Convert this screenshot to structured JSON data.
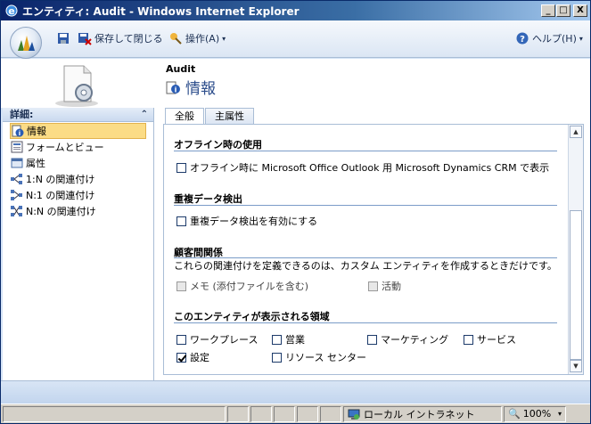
{
  "window": {
    "title": "エンティティ: Audit - Windows Internet Explorer",
    "buttons": [
      "_",
      "□",
      "X"
    ]
  },
  "toolbar": {
    "save_close_label": "保存して閉じる",
    "actions_label": "操作(A)",
    "help_label": "ヘルプ(H)"
  },
  "header": {
    "entity_name": "Audit",
    "section_title": "情報"
  },
  "nav": {
    "title": "詳細:",
    "items": [
      {
        "label": "情報",
        "icon": "info-icon",
        "selected": true
      },
      {
        "label": "フォームとビュー",
        "icon": "form-icon"
      },
      {
        "label": "属性",
        "icon": "attribute-icon"
      },
      {
        "label": "1:N の関連付け",
        "icon": "relation-1n-icon"
      },
      {
        "label": "N:1 の関連付け",
        "icon": "relation-n1-icon"
      },
      {
        "label": "N:N の関連付け",
        "icon": "relation-nn-icon"
      }
    ]
  },
  "tabs": [
    {
      "label": "全般",
      "active": true
    },
    {
      "label": "主属性",
      "active": false
    }
  ],
  "form": {
    "offline": {
      "title": "オフライン時の使用",
      "option": "オフライン時に Microsoft Office Outlook 用 Microsoft Dynamics CRM で表示"
    },
    "duplicate": {
      "title": "重複データ検出",
      "option": "重複データ検出を有効にする"
    },
    "relations": {
      "title": "顧客間関係",
      "description": "これらの関連付けを定義できるのは、カスタム エンティティを作成するときだけです。",
      "notes": "メモ (添付ファイルを含む)",
      "activities": "活動"
    },
    "areas": {
      "title": "このエンティティが表示される領域",
      "items": [
        {
          "label": "ワークプレース",
          "checked": false
        },
        {
          "label": "営業",
          "checked": false
        },
        {
          "label": "マーケティング",
          "checked": false
        },
        {
          "label": "サービス",
          "checked": false
        },
        {
          "label": "設定",
          "checked": true
        },
        {
          "label": "リソース センター",
          "checked": false
        }
      ]
    }
  },
  "status": {
    "zone": "ローカル イントラネット",
    "zoom": "100%"
  }
}
